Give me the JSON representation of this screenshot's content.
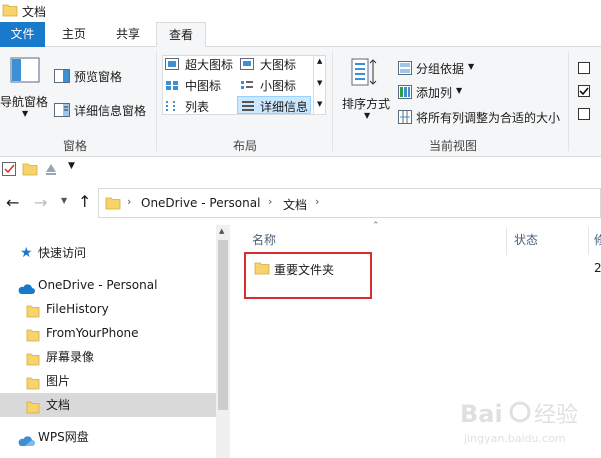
{
  "window": {
    "title": "文档"
  },
  "ribbon_tabs": {
    "file": "文件",
    "home": "主页",
    "share": "共享",
    "view": "查看"
  },
  "panes_group": {
    "nav_pane": "导航窗格",
    "preview_pane": "预览窗格",
    "details_pane": "详细信息窗格",
    "label": "窗格"
  },
  "layout_group": {
    "extra_large": "超大图标",
    "large": "大图标",
    "medium": "中图标",
    "small": "小图标",
    "list": "列表",
    "details": "详细信息",
    "label": "布局"
  },
  "current_view_group": {
    "sort_by": "排序方式",
    "group_by": "分组依据",
    "add_column": "添加列",
    "size_all_columns": "将所有列调整为合适的大小",
    "label": "当前视图"
  },
  "address": {
    "segments": [
      "OneDrive - Personal",
      "文档"
    ]
  },
  "nav": {
    "quick_access": "快速访问",
    "onedrive": "OneDrive - Personal",
    "folders": [
      "FileHistory",
      "FromYourPhone",
      "屏幕录像",
      "图片",
      "文档"
    ],
    "wps": "WPS网盘"
  },
  "columns": {
    "name": "名称",
    "status": "状态",
    "date_partial": "修"
  },
  "files": [
    {
      "name": "重要文件夹",
      "status_partial": "2"
    }
  ],
  "watermark": "Bai 经验 jingyan.baidu.com",
  "colors": {
    "accent": "#1979ca",
    "folder": "#f6d36b",
    "highlight": "#d32f2f",
    "selected": "#d9d9d9"
  }
}
